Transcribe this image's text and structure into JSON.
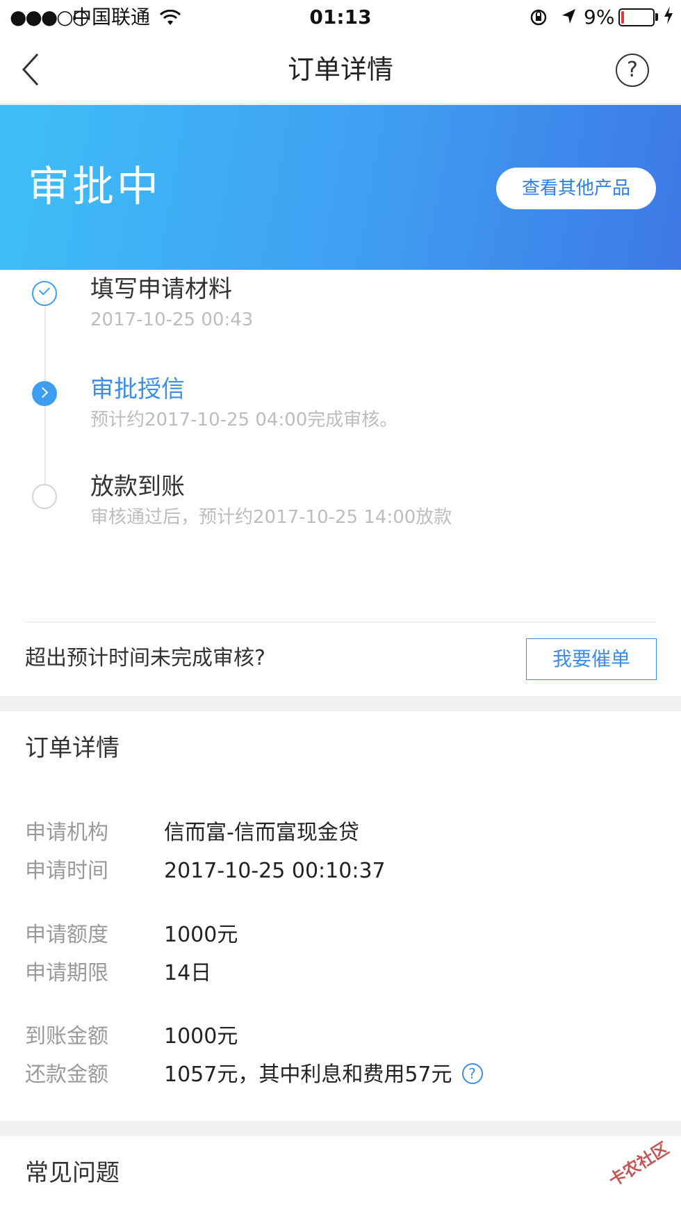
{
  "status_bar": {
    "signal": "●●●○○",
    "carrier": "中国联通",
    "time": "01:13",
    "battery_percent": "9%",
    "battery_level": 0.09
  },
  "nav": {
    "title": "订单详情",
    "help_glyph": "?"
  },
  "hero": {
    "status": "审批中",
    "other_products_label": "查看其他产品"
  },
  "steps": [
    {
      "title": "填写申请材料",
      "sub": "2017-10-25 00:43",
      "state": "done"
    },
    {
      "title": "审批授信",
      "sub": "预计约2017-10-25 04:00完成审核。",
      "state": "current"
    },
    {
      "title": "放款到账",
      "sub": "审核通过后，预计约2017-10-25 14:00放款",
      "state": "pending"
    }
  ],
  "urge": {
    "question": "超出预计时间未完成审核?",
    "button_label": "我要催单"
  },
  "order_details": {
    "title": "订单详情",
    "rows": [
      {
        "label": "申请机构",
        "value": "信而富-信而富现金贷"
      },
      {
        "label": "申请时间",
        "value": "2017-10-25 00:10:37"
      },
      {
        "label": "申请额度",
        "value": "1000元"
      },
      {
        "label": "申请期限",
        "value": "14日"
      },
      {
        "label": "到账金额",
        "value": "1000元"
      },
      {
        "label": "还款金额",
        "value": "1057元，其中利息和费用57元"
      }
    ],
    "info_glyph": "?"
  },
  "faq": {
    "title": "常见问题"
  },
  "watermark": "卡农社区",
  "colors": {
    "accent": "#3d8ee8",
    "hero_gradient_start": "#3fbff7",
    "hero_gradient_end": "#3e78e6",
    "battery_low": "#e53935"
  }
}
